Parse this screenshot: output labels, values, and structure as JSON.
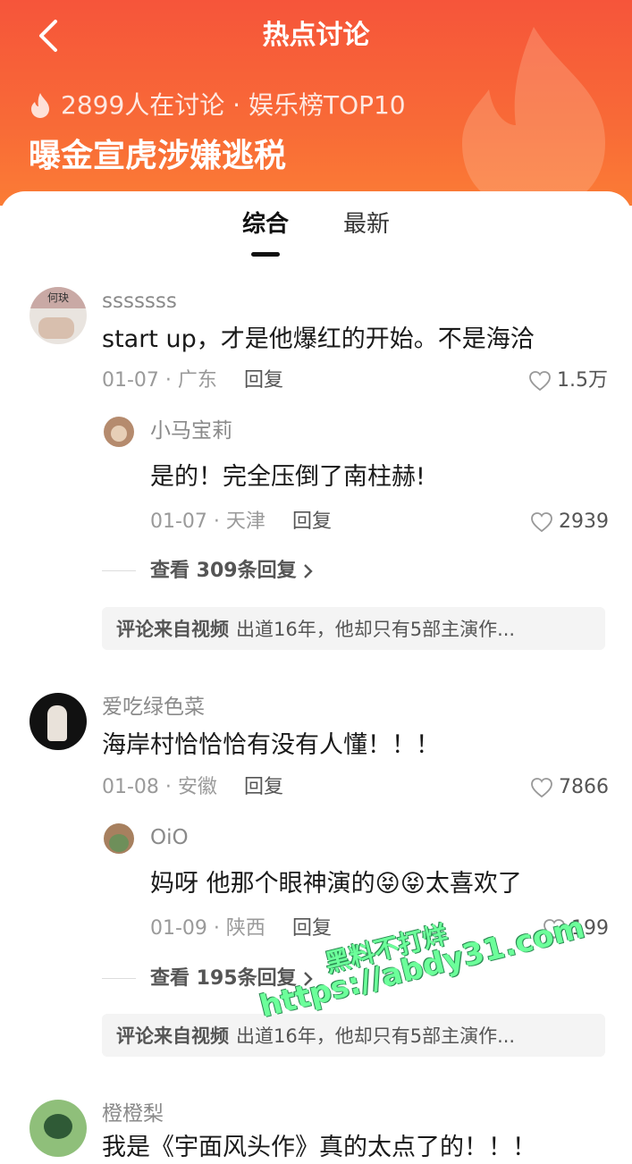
{
  "header": {
    "title": "热点讨论",
    "meta": "2899人在讨论 · 娱乐榜TOP10",
    "headline": "曝金宣虎涉嫌逃税"
  },
  "tabs": [
    {
      "label": "综合",
      "active": true
    },
    {
      "label": "最新",
      "active": false
    }
  ],
  "comments": [
    {
      "user": "sssssss",
      "avatar_text": "何玦",
      "text": "start up，才是他爆红的开始。不是海洽",
      "date_loc": "01-07 · 广东",
      "reply_label": "回复",
      "likes": "1.5万",
      "sub": {
        "user": "小马宝莉",
        "text": "是的！完全压倒了南柱赫!",
        "date_loc": "01-07 · 天津",
        "reply_label": "回复",
        "likes": "2939"
      },
      "view_more": "查看 309条回复",
      "source_label": "评论来自视频",
      "source_text": "出道16年，他却只有5部主演作..."
    },
    {
      "user": "爱吃绿色菜",
      "text": "海岸村恰恰恰有没有人懂！！！",
      "date_loc": "01-08 · 安徽",
      "reply_label": "回复",
      "likes": "7866",
      "sub": {
        "user": "OiO",
        "text": "妈呀 他那个眼神演的😝😝太喜欢了",
        "date_loc": "01-09 · 陕西",
        "reply_label": "回复",
        "likes": "199"
      },
      "view_more": "查看 195条回复",
      "source_label": "评论来自视频",
      "source_text": "出道16年，他却只有5部主演作..."
    },
    {
      "user": "橙橙梨",
      "text": "我是《宇面风头作》真的太点了的！！！"
    }
  ],
  "watermark": {
    "line1": "黑料不打烊",
    "line2": "https://abdy31.com"
  },
  "colors": {
    "header_top": "#f6553a",
    "header_bottom": "#fb7c35",
    "watermark": "#6cff9a"
  }
}
